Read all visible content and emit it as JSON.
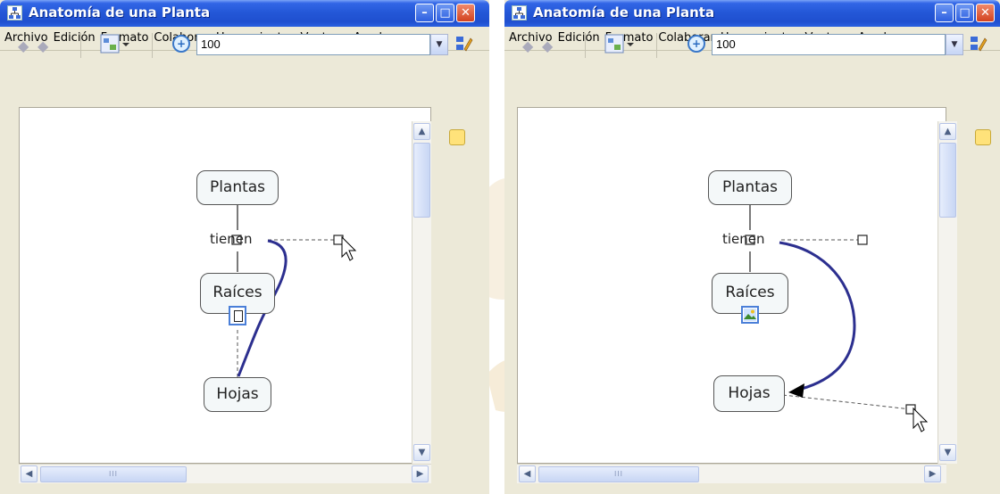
{
  "windows": [
    {
      "title": "Anatomía de una Planta",
      "menu": [
        "Archivo",
        "Edición",
        "Formato",
        "Colaborar",
        "Herramientas",
        "Ventana",
        "Ayuda"
      ],
      "zoom_value": "100",
      "concepts": {
        "top": "Plantas",
        "middle": "Raíces",
        "bottom": "Hojas"
      },
      "link_label": "tienen"
    },
    {
      "title": "Anatomía de una Planta",
      "menu": [
        "Archivo",
        "Edición",
        "Formato",
        "Colaborar",
        "Herramientas",
        "Ventana",
        "Ayuda"
      ],
      "zoom_value": "100",
      "concepts": {
        "top": "Plantas",
        "middle": "Raíces",
        "bottom": "Hojas"
      },
      "link_label": "tienen"
    }
  ],
  "icons": {
    "app": "concept-map-icon",
    "back": "back-arrow-icon",
    "forward": "forward-arrow-icon",
    "view": "view-icon",
    "zoom": "zoom-icon",
    "edit": "edit-icon",
    "side": "palette-icon",
    "resource": "image-resource-icon",
    "cursor": "cursor-icon"
  },
  "colors": {
    "titlebar": "#2458d8",
    "link_curve": "#2c2f8f",
    "close_button": "#d2421f"
  }
}
